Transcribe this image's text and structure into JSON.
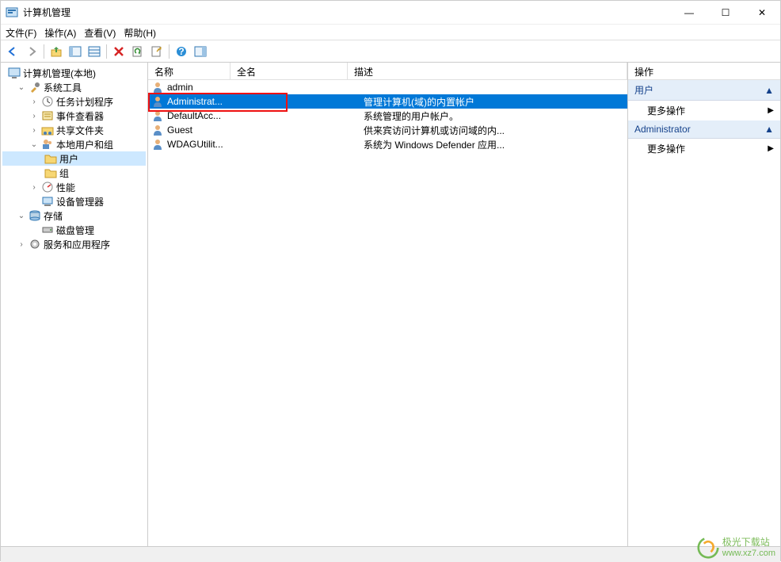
{
  "window": {
    "title": "计算机管理",
    "controls": {
      "minimize": "—",
      "maximize": "☐",
      "close": "✕"
    }
  },
  "menu": {
    "file": "文件(F)",
    "action": "操作(A)",
    "view": "查看(V)",
    "help": "帮助(H)"
  },
  "toolbar_icons": {
    "back": "←",
    "forward": "→",
    "up": "↑",
    "show": "☰",
    "delete": "✕",
    "refresh": "⟳",
    "export": "📄",
    "help": "?",
    "pane": "▥"
  },
  "tree": {
    "root": "计算机管理(本地)",
    "system_tools": "系统工具",
    "task_scheduler": "任务计划程序",
    "event_viewer": "事件查看器",
    "shared_folders": "共享文件夹",
    "local_users_groups": "本地用户和组",
    "users": "用户",
    "groups": "组",
    "performance": "性能",
    "device_manager": "设备管理器",
    "storage": "存储",
    "disk_management": "磁盘管理",
    "services_apps": "服务和应用程序"
  },
  "columns": {
    "name": "名称",
    "fullname": "全名",
    "description": "描述"
  },
  "users": [
    {
      "name": "admin",
      "fullname": "",
      "description": ""
    },
    {
      "name": "Administrat...",
      "fullname": "",
      "description": "管理计算机(域)的内置帐户",
      "selected": true,
      "highlighted": true
    },
    {
      "name": "DefaultAcc...",
      "fullname": "",
      "description": "系统管理的用户帐户。"
    },
    {
      "name": "Guest",
      "fullname": "",
      "description": "供来宾访问计算机或访问域的内..."
    },
    {
      "name": "WDAGUtilit...",
      "fullname": "",
      "description": "系统为 Windows Defender 应用..."
    }
  ],
  "actions": {
    "header": "操作",
    "group1": "用户",
    "more1": "更多操作",
    "group2": "Administrator",
    "more2": "更多操作"
  },
  "watermark": {
    "title": "极光下载站",
    "url": "www.xz7.com"
  }
}
